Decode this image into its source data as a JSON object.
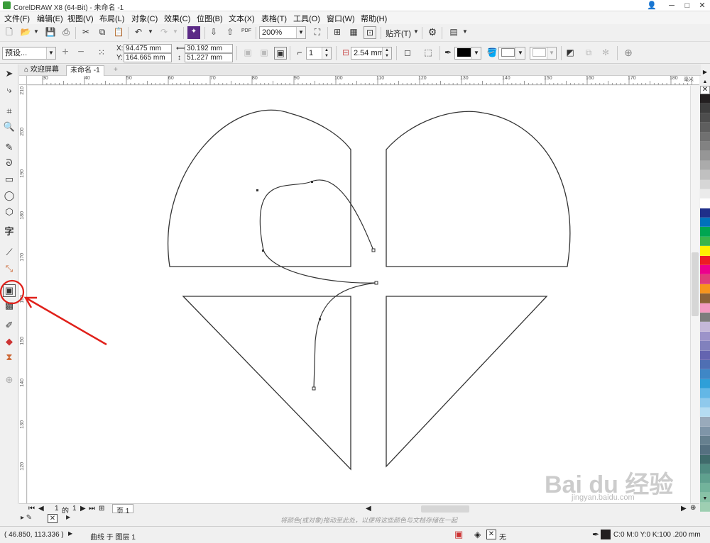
{
  "window": {
    "title": "CorelDRAW X8 (64-Bit) - 未命名 -1"
  },
  "window_controls": {
    "min": "─",
    "max": "□",
    "close": "✕",
    "extra": "👤"
  },
  "menu": [
    "文件(F)",
    "编辑(E)",
    "视图(V)",
    "布局(L)",
    "对象(C)",
    "效果(C)",
    "位图(B)",
    "文本(X)",
    "表格(T)",
    "工具(O)",
    "窗口(W)",
    "帮助(H)"
  ],
  "toolbar": {
    "zoom_value": "200%",
    "snap_label": "贴齐(T)",
    "pdf_label": "PDF"
  },
  "property_bar": {
    "preset": "预设...",
    "x_label": "X:",
    "x_value": "94.475 mm",
    "y_label": "Y:",
    "y_value": "164.665 mm",
    "w_value": "30.192 mm",
    "h_value": "51.227 mm",
    "count_value": "1",
    "stroke_width": "2.54 mm"
  },
  "tabs": {
    "welcome": "欢迎屏幕",
    "document": "未命名 -1",
    "add": "+"
  },
  "ruler": {
    "h_ticks": [
      "30",
      "40",
      "50",
      "60",
      "70",
      "80",
      "90",
      "100",
      "110",
      "120",
      "130",
      "140",
      "150",
      "160",
      "170",
      "180"
    ],
    "h_unit": "毫米",
    "v_ticks": [
      "210",
      "200",
      "190",
      "180",
      "170",
      "160",
      "150",
      "140",
      "130",
      "120"
    ]
  },
  "pagebar": {
    "current": "1",
    "of": "的",
    "total": "1",
    "page_tab": "页 1"
  },
  "hint": "将颜色(或对象)拖动至此处，以便将这些颜色与文档存储在一起",
  "status": {
    "coords": "( 46.850, 113.336 )",
    "object_info": "曲线 于 图层 1",
    "fill_none": "无",
    "stroke_info": "C:0 M:0 Y:0 K:100  .200 mm"
  },
  "watermark": {
    "brand": "Bai  du 经验",
    "url": "jingyan.baidu.com"
  },
  "palette_colors": [
    "#231f20",
    "#3d3d3d",
    "#4d4d4d",
    "#5e5e5e",
    "#707070",
    "#828282",
    "#969696",
    "#ababab",
    "#c0c0c0",
    "#d6d6d6",
    "#ebebeb",
    "#ffffff",
    "#1f2f8a",
    "#0072bc",
    "#00a651",
    "#39b54a",
    "#fff200",
    "#ed1c24",
    "#ec008c",
    "#e03c7a",
    "#f7941d",
    "#8c6239",
    "#f49ac1",
    "#7d7d7d",
    "#c4b8d9",
    "#9c93c9",
    "#8181bd",
    "#6464b0",
    "#4f6fb3",
    "#3f87c6",
    "#2e9fd8",
    "#63b7e6",
    "#8fc9ec",
    "#b5dcf2",
    "#99aabb",
    "#7f95a8",
    "#66808f",
    "#557080",
    "#3f6b6b",
    "#4f8a80",
    "#5fa08e",
    "#72b39b",
    "#88c2a6",
    "#9ecfb2"
  ],
  "colors": {
    "accent": "#d9321c",
    "doc_black": "#000000"
  }
}
